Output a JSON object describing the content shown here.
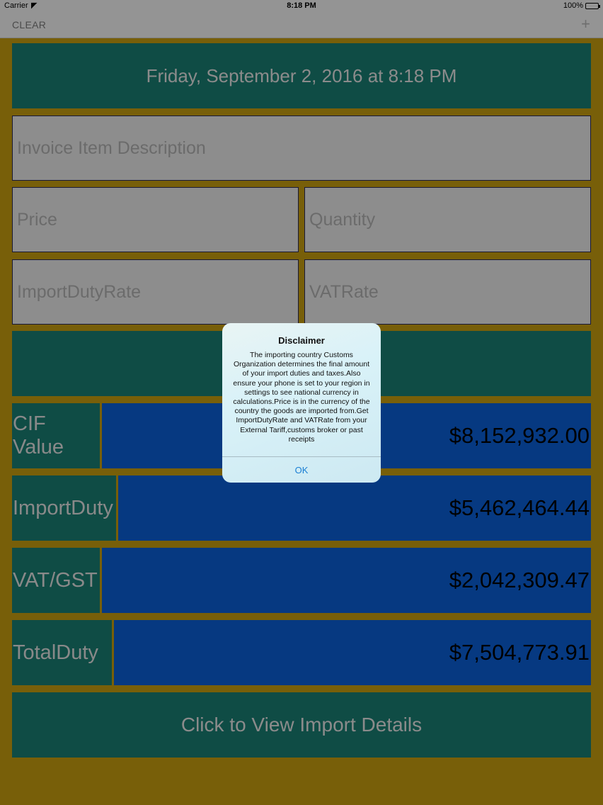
{
  "status_bar": {
    "carrier": "Carrier",
    "time": "8:18 PM",
    "battery": "100%"
  },
  "nav": {
    "clear_label": "CLEAR",
    "add_label": "+"
  },
  "date_banner": "Friday, September 2, 2016 at 8:18 PM",
  "form": {
    "description_placeholder": "Invoice Item Description",
    "price_placeholder": "Price",
    "quantity_placeholder": "Quantity",
    "import_duty_rate_placeholder": "ImportDutyRate",
    "vat_rate_placeholder": "VATRate"
  },
  "results": {
    "cif_label": "CIF Value",
    "cif_value": "$8,152,932.00",
    "import_duty_label": "ImportDuty",
    "import_duty_value": "$5,462,464.44",
    "vat_label": "VAT/GST",
    "vat_value": "$2,042,309.47",
    "total_label": "TotalDuty",
    "total_value": "$7,504,773.91"
  },
  "details_button": "Click to View Import Details",
  "alert": {
    "title": "Disclaimer",
    "message": "The importing country Customs Organization determines the final amount of your import duties and taxes.Also ensure your phone is set to your region in settings to see national currency in calculations.Price is in the currency of the country the goods are imported from.Get ImportDutyRate and VATRate from your External Tariff,customs broker or past receipts",
    "ok_label": "OK"
  },
  "colors": {
    "background": "#c89f10",
    "teal": "#1a7f74",
    "blue": "#0a5fd8",
    "alert_button": "#1a7fd4"
  }
}
